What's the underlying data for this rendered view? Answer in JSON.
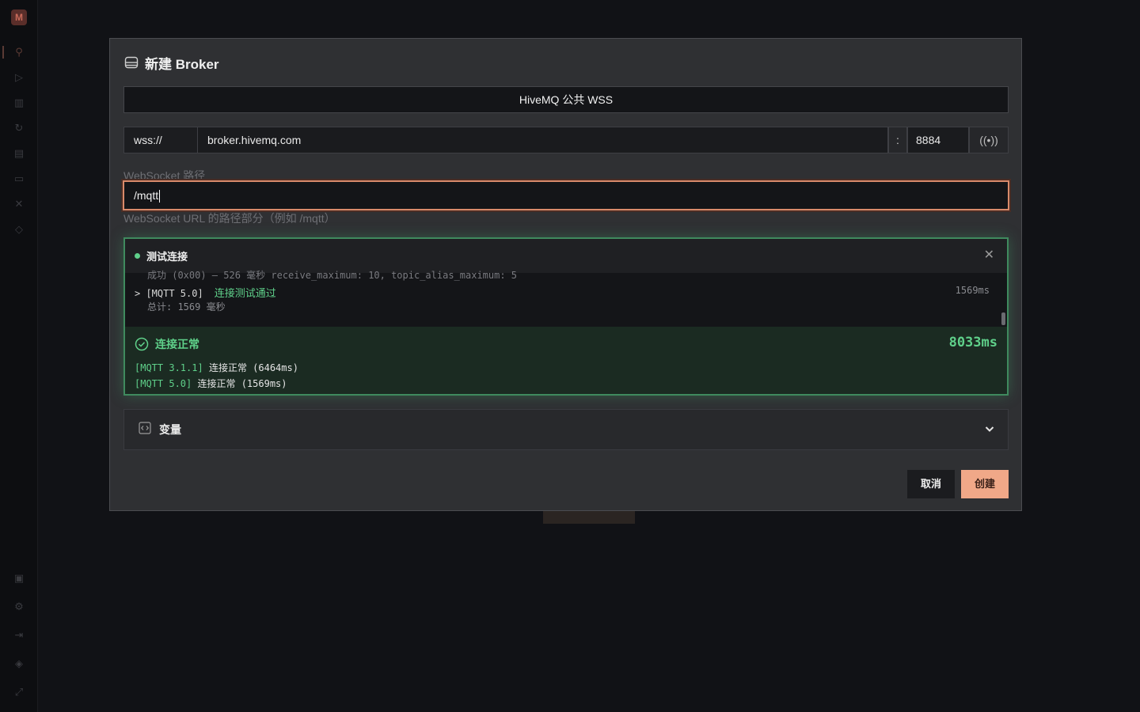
{
  "dialog": {
    "title": "新建 Broker",
    "title_icon": "server-icon",
    "name_value": "HiveMQ 公共 WSS",
    "protocol": "wss://",
    "host": "broker.hivemq.com",
    "colon": ":",
    "port": "8884",
    "test_icon": "broadcast-icon",
    "path_label": "WebSocket 路径",
    "path_value": "/mqtt",
    "path_hint": "WebSocket URL 的路径部分（例如 /mqtt）",
    "cancel_label": "取消",
    "create_label": "创建"
  },
  "test_panel": {
    "title": "测试连接",
    "close_icon": "close-icon",
    "log_cut_line": "成功 (0x00) — 526 毫秒 receive_maximum: 10, topic_alias_maximum: 5",
    "log_prefix": "> [MQTT 5.0]",
    "log_message": "连接测试通过",
    "log_ms": "1569ms",
    "log_total": "总计: 1569 毫秒",
    "result_title": "连接正常",
    "result_time": "8033ms",
    "results": [
      {
        "tag": "[MQTT 3.1.1]",
        "text": "连接正常 (6464ms)"
      },
      {
        "tag": "[MQTT 5.0]",
        "text": "连接正常 (1569ms)"
      }
    ]
  },
  "variables": {
    "label": "变量",
    "icon": "code-icon",
    "chevron": "chevron-down-icon"
  },
  "colors": {
    "accent": "#f0a888",
    "success": "#5fd08a",
    "focus_border": "#d98a6a"
  }
}
